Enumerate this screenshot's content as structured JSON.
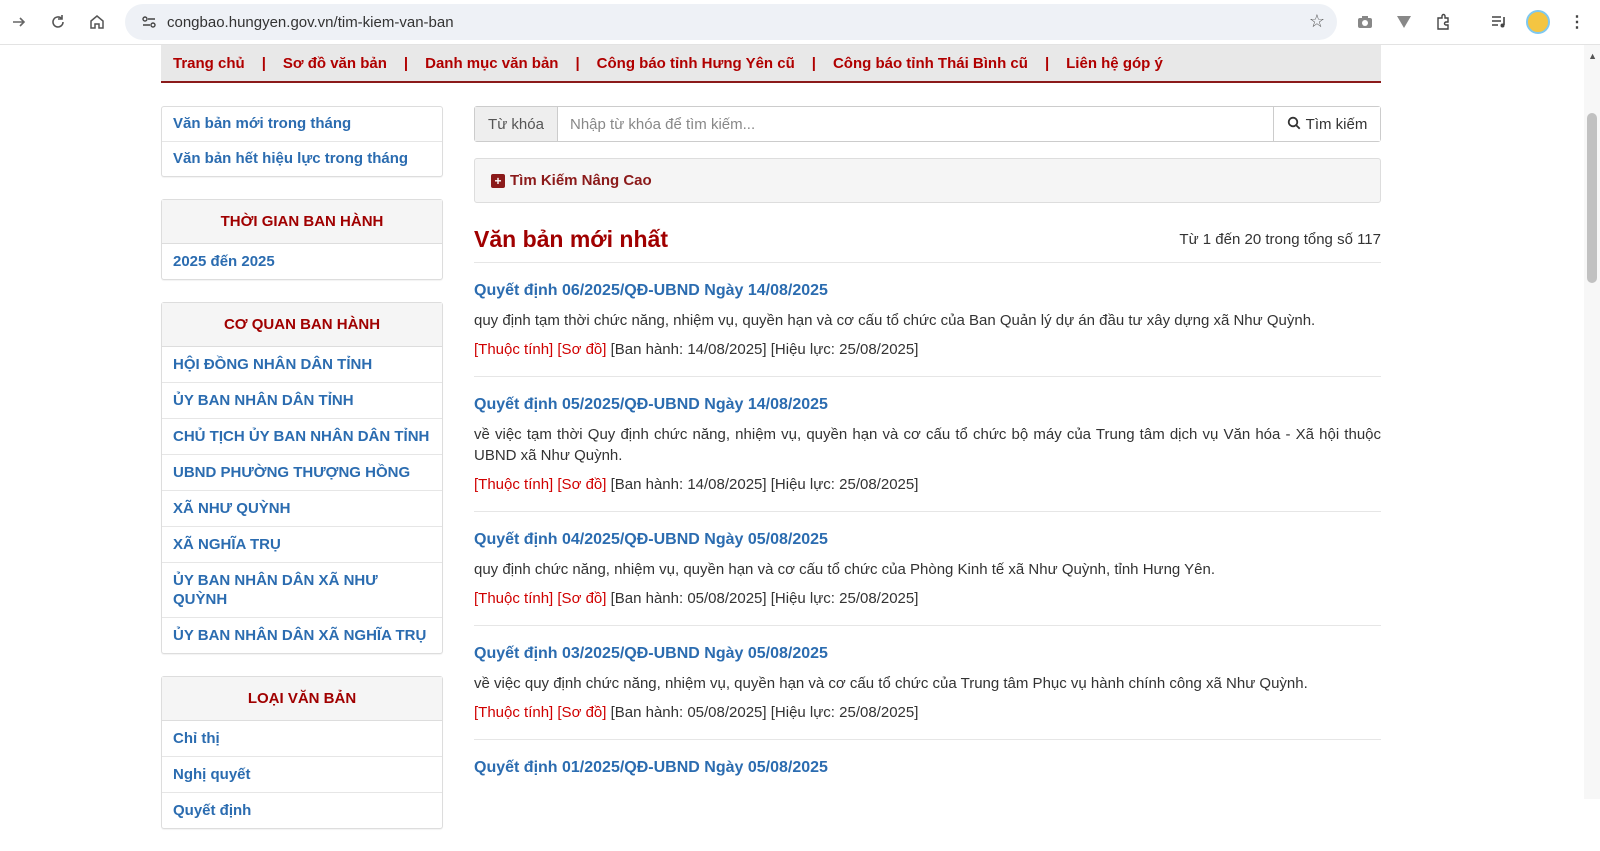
{
  "browser": {
    "url": "congbao.hungyen.gov.vn/tim-kiem-van-ban",
    "icons": [
      "forward-icon",
      "reload-icon",
      "home-icon",
      "site-info-icon",
      "star-icon",
      "camera-icon",
      "vpn-icon",
      "extensions-icon",
      "media-icon",
      "profile-avatar",
      "menu-icon"
    ]
  },
  "topnav": {
    "items": [
      "Trang chủ",
      "Sơ đồ văn bản",
      "Danh mục văn bản",
      "Công báo tỉnh Hưng Yên cũ",
      "Công báo tỉnh Thái Bình cũ",
      "Liên hệ góp ý"
    ],
    "separator": "|"
  },
  "sidebar": {
    "quick_links": [
      "Văn bản mới trong tháng",
      "Văn bản hết hiệu lực trong tháng"
    ],
    "time_panel": {
      "title": "THỜI GIAN BAN HÀNH",
      "items": [
        "2025 đến 2025"
      ]
    },
    "agency_panel": {
      "title": "CƠ QUAN BAN HÀNH",
      "items": [
        "HỘI ĐỒNG NHÂN DÂN TỈNH",
        "ỦY BAN NHÂN DÂN TỈNH",
        "CHỦ TỊCH ỦY BAN NHÂN DÂN TỈNH",
        "UBND PHƯỜNG THƯỢNG HỒNG",
        "XÃ NHƯ QUỲNH",
        "XÃ NGHĨA TRỤ",
        "ỦY BAN NHÂN DÂN XÃ NHƯ QUỲNH",
        "ỦY BAN NHÂN DÂN XÃ NGHĨA TRỤ"
      ]
    },
    "type_panel": {
      "title": "LOẠI VĂN BẢN",
      "items": [
        "Chỉ thị",
        "Nghị quyết",
        "Quyết định"
      ]
    }
  },
  "search": {
    "label": "Từ khóa",
    "placeholder": "Nhập từ khóa để tìm kiếm...",
    "button": "Tìm kiếm"
  },
  "advanced": {
    "label": "Tìm Kiếm Nâng Cao"
  },
  "list": {
    "title": "Văn bản mới nhất",
    "count": "Từ 1 đến 20 trong tổng số 117",
    "docs": [
      {
        "title": "Quyết định 06/2025/QĐ-UBND Ngày 14/08/2025",
        "desc": "quy định tạm thời chức năng, nhiệm vụ, quyền hạn và cơ cấu tổ chức của Ban Quản lý dự án đầu tư xây dựng xã Như Quỳnh.",
        "attr": "[Thuộc tính]",
        "diagram": "[Sơ đồ]",
        "issued": "[Ban hành: 14/08/2025]",
        "effective": "[Hiệu lực: 25/08/2025]"
      },
      {
        "title": "Quyết định 05/2025/QĐ-UBND Ngày 14/08/2025",
        "desc": "về việc tạm thời Quy định chức năng, nhiệm vụ, quyền hạn và cơ cấu tổ chức bộ máy của Trung tâm dịch vụ Văn hóa - Xã hội thuộc UBND xã Như Quỳnh.",
        "attr": "[Thuộc tính]",
        "diagram": "[Sơ đồ]",
        "issued": "[Ban hành: 14/08/2025]",
        "effective": "[Hiệu lực: 25/08/2025]"
      },
      {
        "title": "Quyết định 04/2025/QĐ-UBND Ngày 05/08/2025",
        "desc": "quy định chức năng, nhiệm vụ, quyền hạn và cơ cấu tổ chức của Phòng Kinh tế xã Như Quỳnh, tỉnh Hưng Yên.",
        "attr": "[Thuộc tính]",
        "diagram": "[Sơ đồ]",
        "issued": "[Ban hành: 05/08/2025]",
        "effective": "[Hiệu lực: 25/08/2025]"
      },
      {
        "title": "Quyết định 03/2025/QĐ-UBND Ngày 05/08/2025",
        "desc": "về việc quy định chức năng, nhiệm vụ, quyền hạn và cơ cấu tổ chức của Trung tâm Phục vụ hành chính công xã Như Quỳnh.",
        "attr": "[Thuộc tính]",
        "diagram": "[Sơ đồ]",
        "issued": "[Ban hành: 05/08/2025]",
        "effective": "[Hiệu lực: 25/08/2025]"
      },
      {
        "title": "Quyết định 01/2025/QĐ-UBND Ngày 05/08/2025"
      }
    ]
  }
}
